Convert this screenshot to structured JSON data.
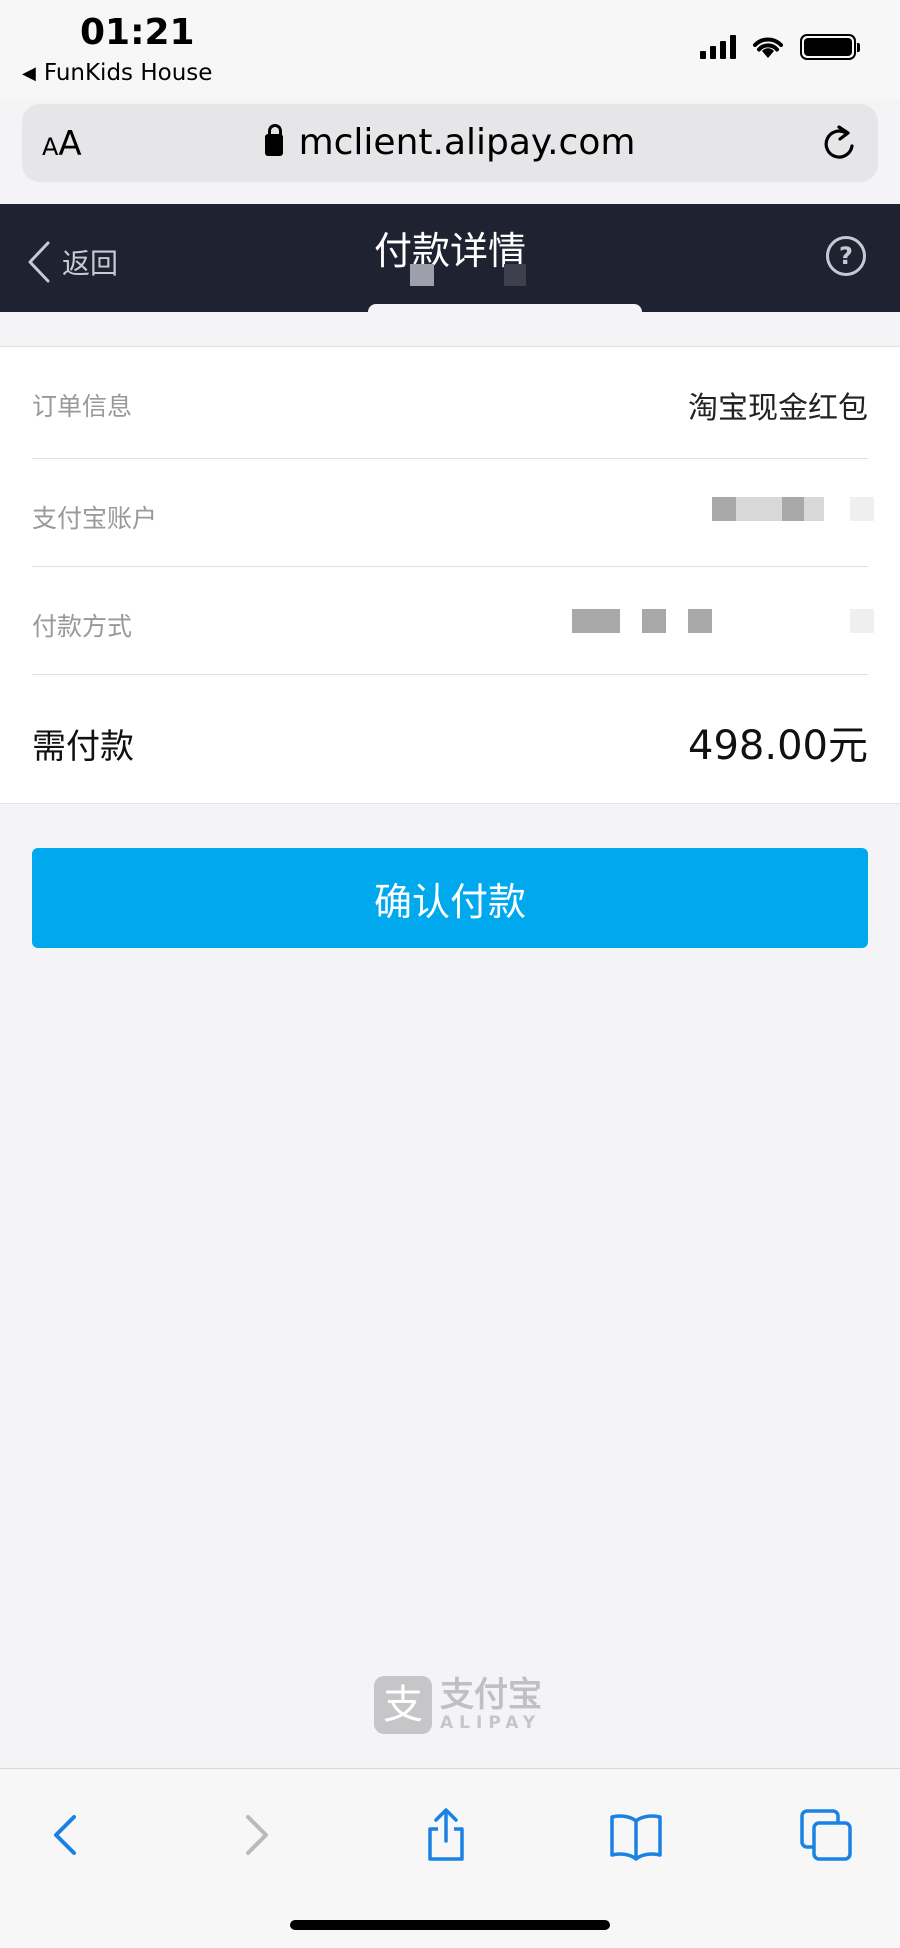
{
  "status_bar": {
    "time": "01:21",
    "back_app": "FunKids House"
  },
  "url_bar": {
    "aa_label_small": "A",
    "aa_label_large": "A",
    "url": "mclient.alipay.com"
  },
  "header": {
    "back_label": "返回",
    "title": "付款详情",
    "help_label": "?"
  },
  "order": {
    "rows": [
      {
        "label": "订单信息",
        "value": "淘宝现金红包"
      },
      {
        "label": "支付宝账户",
        "value": ""
      },
      {
        "label": "付款方式",
        "value": ""
      }
    ],
    "total_label": "需付款",
    "total_value": "498.00元"
  },
  "confirm_button": "确认付款",
  "footer_logo": {
    "mark": "支",
    "cn": "支付宝",
    "en": "ALIPAY"
  },
  "colors": {
    "header_bg": "#1f2230",
    "button_bg": "#00a9ee",
    "toolbar_icon": "#1a82e2"
  }
}
